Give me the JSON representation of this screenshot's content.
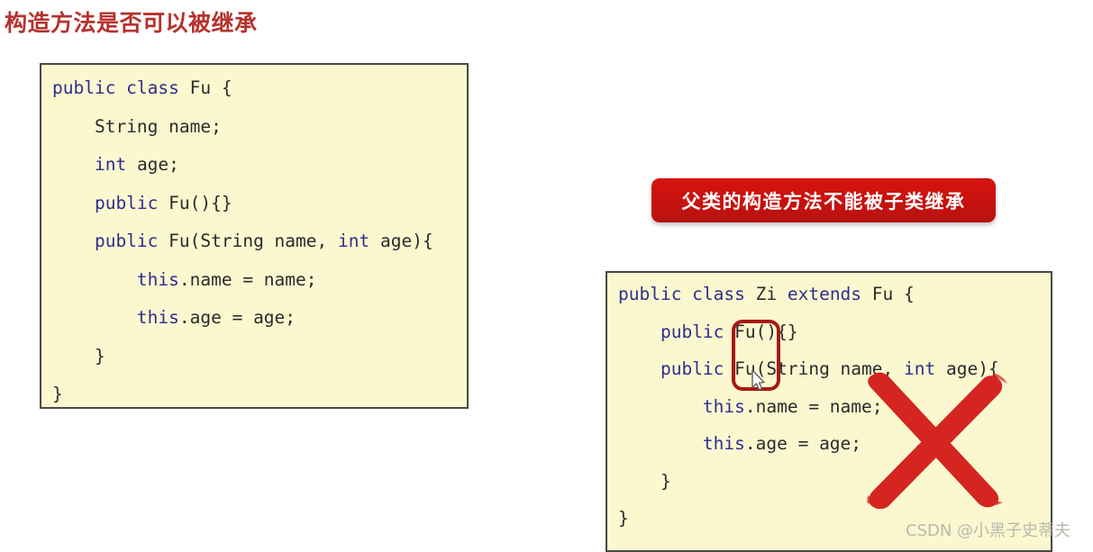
{
  "slide": {
    "title": "构造方法是否可以被继承"
  },
  "callout": {
    "text": "父类的构造方法不能被子类继承",
    "bg_color": "#c6120f",
    "text_color": "#ffffff"
  },
  "code_left": {
    "name": "Fu class source",
    "bg_color": "#fbf8d0",
    "border_color": "#4a4a42",
    "keyword_color": "#2e2e8f",
    "identifier_color": "#2b2b2b",
    "lines": [
      [
        {
          "t": "public class",
          "c": "kw"
        },
        {
          "t": " Fu {",
          "c": "id"
        }
      ],
      [
        {
          "t": "    ",
          "c": "id"
        },
        {
          "t": "String name;",
          "c": "id"
        }
      ],
      [
        {
          "t": "    ",
          "c": "id"
        },
        {
          "t": "int",
          "c": "kw"
        },
        {
          "t": " age;",
          "c": "id"
        }
      ],
      [
        {
          "t": "    ",
          "c": "id"
        },
        {
          "t": "public",
          "c": "kw"
        },
        {
          "t": " Fu(){}",
          "c": "id"
        }
      ],
      [
        {
          "t": "    ",
          "c": "id"
        },
        {
          "t": "public",
          "c": "kw"
        },
        {
          "t": " Fu(String name, ",
          "c": "id"
        },
        {
          "t": "int",
          "c": "kw"
        },
        {
          "t": " age){",
          "c": "id"
        }
      ],
      [
        {
          "t": "        ",
          "c": "id"
        },
        {
          "t": "this",
          "c": "kw"
        },
        {
          "t": ".name = name;",
          "c": "id"
        }
      ],
      [
        {
          "t": "        ",
          "c": "id"
        },
        {
          "t": "this",
          "c": "kw"
        },
        {
          "t": ".age = age;",
          "c": "id"
        }
      ],
      [
        {
          "t": "    }",
          "c": "id"
        }
      ],
      [
        {
          "t": "}",
          "c": "id"
        }
      ]
    ]
  },
  "code_right": {
    "name": "Zi class source",
    "bg_color": "#fbf8d0",
    "border_color": "#4a4a42",
    "lines": [
      [
        {
          "t": "public class",
          "c": "kw"
        },
        {
          "t": " Zi ",
          "c": "id"
        },
        {
          "t": "extends",
          "c": "kw"
        },
        {
          "t": " Fu {",
          "c": "id"
        }
      ],
      [
        {
          "t": "    ",
          "c": "id"
        },
        {
          "t": "public",
          "c": "kw"
        },
        {
          "t": " Fu(){}",
          "c": "id"
        }
      ],
      [
        {
          "t": "    ",
          "c": "id"
        },
        {
          "t": "public",
          "c": "kw"
        },
        {
          "t": " Fu(String name, ",
          "c": "id"
        },
        {
          "t": "int",
          "c": "kw"
        },
        {
          "t": " age){",
          "c": "id"
        }
      ],
      [
        {
          "t": "        ",
          "c": "id"
        },
        {
          "t": "this",
          "c": "kw"
        },
        {
          "t": ".name = name;",
          "c": "id"
        }
      ],
      [
        {
          "t": "        ",
          "c": "id"
        },
        {
          "t": "this",
          "c": "kw"
        },
        {
          "t": ".age = age;",
          "c": "id"
        }
      ],
      [
        {
          "t": "    }",
          "c": "id"
        }
      ],
      [
        {
          "t": "}",
          "c": "id"
        }
      ]
    ]
  },
  "annotations": {
    "highlight_rect_color": "#a81a14",
    "x_mark_color": "#d42520"
  },
  "watermark": {
    "text": "CSDN @小黑子史蒂夫"
  }
}
